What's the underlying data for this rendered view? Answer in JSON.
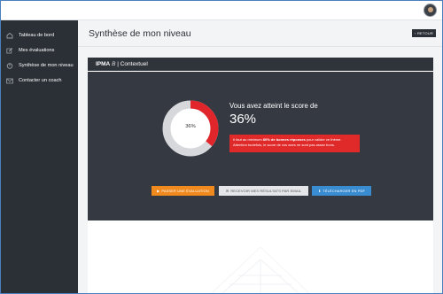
{
  "sidebar": {
    "items": [
      {
        "label": "Tableau de bord",
        "icon": "dashboard-icon"
      },
      {
        "label": "Mes évaluations",
        "icon": "edit-icon"
      },
      {
        "label": "Synthèse de mon niveau",
        "icon": "chart-icon"
      },
      {
        "label": "Contacter un coach",
        "icon": "mail-icon"
      }
    ]
  },
  "header": {
    "title": "Synthèse de mon niveau",
    "back_label": "‹ RETOUR"
  },
  "card": {
    "title_bold": "IPMA",
    "title_italic": "B",
    "title_rest": "| Contextuel"
  },
  "score": {
    "intro": "Vous avez atteint le score de",
    "value_label": "36%",
    "percent": 36,
    "donut_label": "36%",
    "alert_prefix": "Il faut au minimum ",
    "alert_bold": "80% de bonnes réponses",
    "alert_suffix": " pour valider ce thème.",
    "alert_line2": "Attention toutefois, le score de vos axes ne sont pas assez bons."
  },
  "actions": {
    "retake": "PASSER UNE ÉVALUATION",
    "email": "RECEVOIR MES RÉSULTATS PAR EMAIL",
    "download": "TÉLÉCHARGER EN PDF"
  },
  "colors": {
    "sidebar_bg": "#2b2f36",
    "card_bg": "#353a42",
    "alert_red": "#e02a2a",
    "donut_red": "#e0262a",
    "btn_orange": "#f0891e",
    "btn_blue": "#3a8cd0"
  }
}
